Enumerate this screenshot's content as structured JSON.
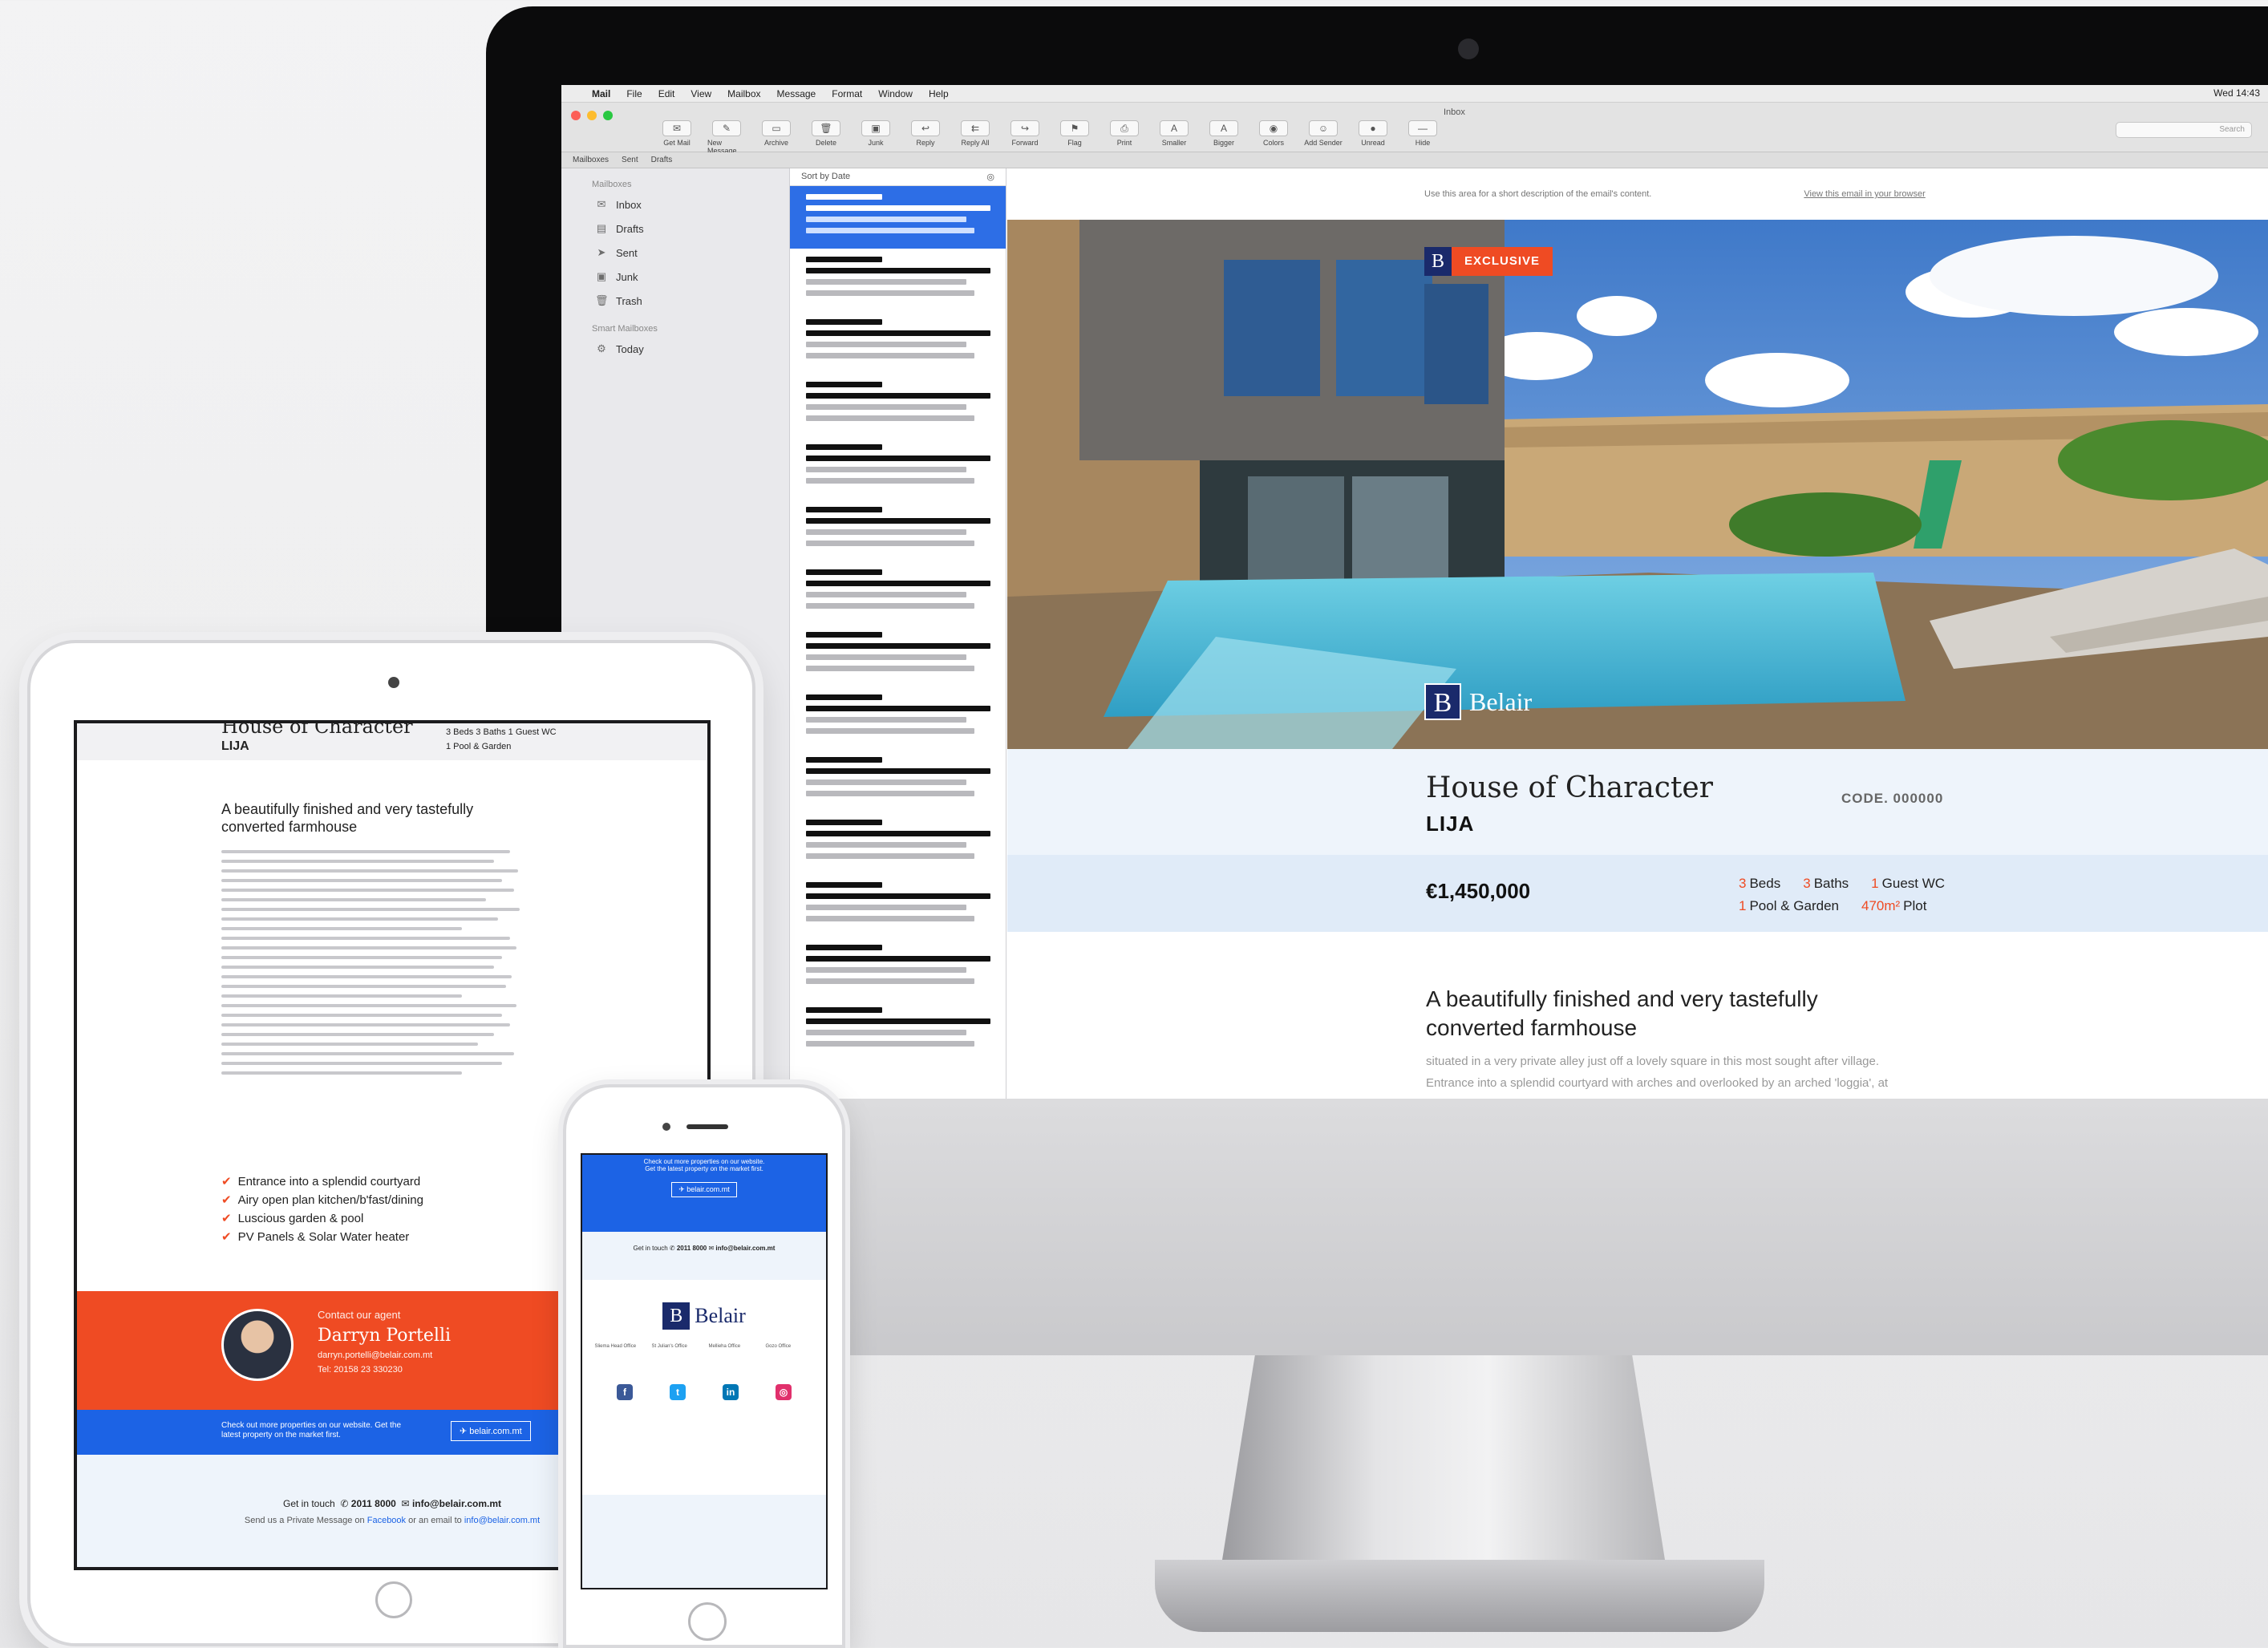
{
  "menubar": {
    "apple": "",
    "items": [
      "Mail",
      "File",
      "Edit",
      "View",
      "Mailbox",
      "Message",
      "Format",
      "Window",
      "Help"
    ],
    "clock": "Wed 14:43"
  },
  "toolbar": {
    "window_title": "Inbox",
    "buttons": [
      {
        "label": "Get Mail",
        "icon": "envelope-icon"
      },
      {
        "label": "New Message",
        "icon": "compose-icon"
      },
      {
        "label": "Archive",
        "icon": "archive-icon"
      },
      {
        "label": "Delete",
        "icon": "trash-icon"
      },
      {
        "label": "Junk",
        "icon": "junk-icon"
      },
      {
        "label": "Reply",
        "icon": "reply-icon"
      },
      {
        "label": "Reply All",
        "icon": "reply-all-icon"
      },
      {
        "label": "Forward",
        "icon": "forward-icon"
      },
      {
        "label": "Flag",
        "icon": "flag-icon"
      },
      {
        "label": "Print",
        "icon": "print-icon"
      },
      {
        "label": "Smaller",
        "icon": "font-smaller-icon"
      },
      {
        "label": "Bigger",
        "icon": "font-bigger-icon"
      },
      {
        "label": "Colors",
        "icon": "colors-icon"
      },
      {
        "label": "Add Sender",
        "icon": "add-sender-icon"
      },
      {
        "label": "Unread",
        "icon": "unread-icon"
      },
      {
        "label": "Hide",
        "icon": "hide-icon"
      }
    ],
    "search_placeholder": "Search"
  },
  "favorites_bar": [
    "Mailboxes",
    "Sent",
    "Drafts"
  ],
  "sidebar": {
    "header": "Mailboxes",
    "items": [
      {
        "label": "Inbox",
        "icon": "inbox-icon"
      },
      {
        "label": "Drafts",
        "icon": "drafts-icon"
      },
      {
        "label": "Sent",
        "icon": "sent-icon"
      },
      {
        "label": "Junk",
        "icon": "junk-icon"
      },
      {
        "label": "Trash",
        "icon": "trash-icon"
      }
    ],
    "smart_header": "Smart Mailboxes",
    "smart_items": [
      {
        "label": "Today",
        "icon": "gear-icon"
      }
    ]
  },
  "message_list": {
    "sort_label": "Sort by Date"
  },
  "email": {
    "preheader": "Use this area for a short description of the email's content.",
    "view_in_browser": "View this email in your browser",
    "badge": "EXCLUSIVE",
    "logo_letter": "B",
    "brand": "Belair",
    "title": "House of Character",
    "location": "LIJA",
    "code": "CODE. 000000",
    "price": "€1,450,000",
    "facts": {
      "beds_n": "3",
      "beds": "Beds",
      "baths_n": "3",
      "baths": "Baths",
      "wc_n": "1",
      "wc": "Guest WC",
      "pool_n": "1",
      "pool": "Pool & Garden",
      "plot_n": "470m²",
      "plot": "Plot"
    },
    "headline": "A beautifully finished and very tastefully converted farmhouse",
    "body": "situated in a very private alley just off a lovely square in this most sought after village. Entrance into a splendid courtyard with arches and overlooked by an arched 'loggia', at ground level one finds a very"
  },
  "ipad": {
    "title": "House of Character",
    "location": "LIJA",
    "facts_line1": "3 Beds   3 Baths   1 Guest WC",
    "facts_line2": "1 Pool & Garden",
    "headline": "A beautifully finished and very tastefully converted farmhouse",
    "bullets": [
      "Entrance into a splendid courtyard",
      "Airy open plan kitchen/b'fast/dining",
      "Luscious garden & pool",
      "PV Panels & Solar Water heater"
    ],
    "contact_label": "Contact our agent",
    "agent_name": "Darryn Portelli",
    "agent_email": "darryn.portelli@belair.com.mt",
    "agent_tel": "Tel: 20158 23 330230",
    "cta_text": "Check out more properties on our website. Get the latest property on the market first.",
    "cta_button": "belair.com.mt",
    "get_in_touch": "Get in touch",
    "phone": "2011 8000",
    "email": "info@belair.com.mt",
    "send_line_pre": "Send us a Private Message on",
    "facebook": "Facebook",
    "send_line_mid": "or an email to",
    "send_email": "info@belair.com.mt"
  },
  "iphone": {
    "cta_line1": "Check out more properties on our website.",
    "cta_line2": "Get the latest property on the market first.",
    "cta_button": "belair.com.mt",
    "get_in_touch": "Get in touch",
    "phone": "2011 8000",
    "email": "info@belair.com.mt",
    "logo_letter": "B",
    "brand": "Belair",
    "offices": [
      "Sliema Head Office",
      "St Julian's Office",
      "Mellieha Office",
      "Gozo Office"
    ],
    "social": [
      {
        "icon": "facebook-icon",
        "glyph": "f",
        "color": "#3b5998"
      },
      {
        "icon": "twitter-icon",
        "glyph": "t",
        "color": "#1da1f2"
      },
      {
        "icon": "linkedin-icon",
        "glyph": "in",
        "color": "#0077b5"
      },
      {
        "icon": "instagram-icon",
        "glyph": "◎",
        "color": "#e1306c"
      }
    ]
  },
  "colors": {
    "accent_orange": "#ef4b23",
    "brand_navy": "#1a2a6b",
    "cta_blue": "#1c63e5",
    "mail_selection": "#2d6ee6"
  }
}
